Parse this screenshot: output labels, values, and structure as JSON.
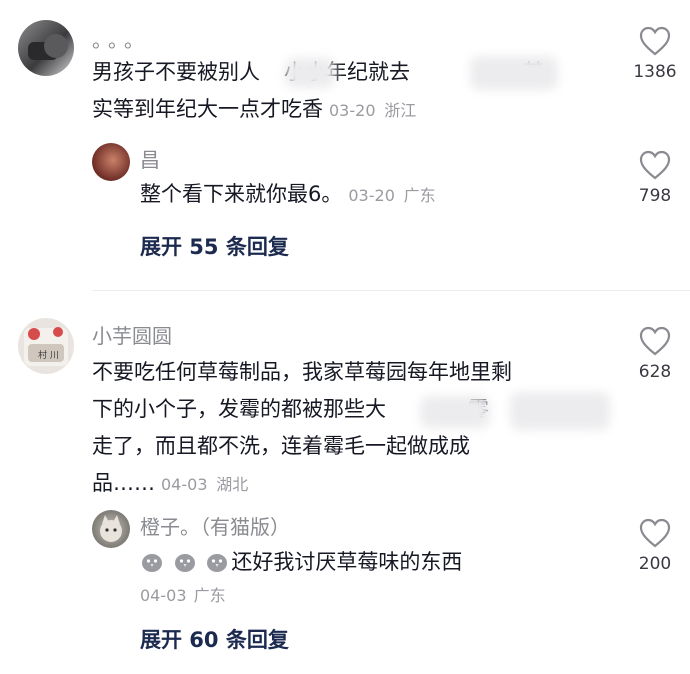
{
  "comments": [
    {
      "username": "。。。",
      "text_line1": "男孩子不要被别人",
      "text_line1b": "小小年纪就去",
      "text_line1c": "，其",
      "text_line2": "实等到年纪大一点才吃香",
      "date": "03-20",
      "location": "浙江",
      "likes": "1386",
      "reply": {
        "username": "昌",
        "text": "整个看下来就你最6。",
        "date": "03-20",
        "location": "广东",
        "likes": "798"
      },
      "expand_label": "展开 55 条回复"
    },
    {
      "username": "小芋圆圆",
      "text_line1": "不要吃任何草莓制品，我家草莓园每年地里剩",
      "text_line2": "下的小个子，发霉的都被那些大",
      "text_line2b": "零",
      "text_line3": "走了，而且都不洗，连着霉毛一起做成成",
      "text_line4": "品……",
      "date": "04-03",
      "location": "湖北",
      "likes": "628",
      "reply": {
        "username": "橙子。（有猫版）",
        "text": "还好我讨厌草莓味的东西",
        "emoji": "chick-face",
        "date": "04-03",
        "location": "广东",
        "likes": "200"
      },
      "expand_label": "展开 60 条回复"
    }
  ],
  "colors": {
    "accent_link": "#1b2a4e",
    "meta_gray": "#9a9ba1",
    "text": "#161823"
  }
}
